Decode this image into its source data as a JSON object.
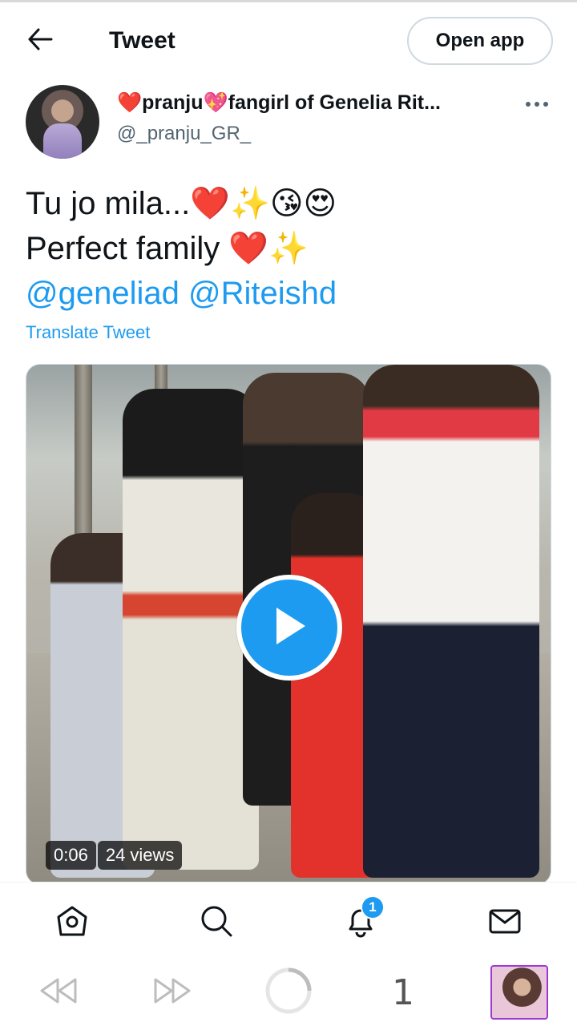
{
  "header": {
    "title": "Tweet",
    "open_app_label": "Open app"
  },
  "author": {
    "name": "❤️pranju💖fangirl of Genelia Rit...",
    "handle": "@_pranju_GR_"
  },
  "tweet": {
    "line1": "Tu jo mila...❤️✨😘😍",
    "line2": "Perfect family ❤️✨",
    "mentions": [
      "@geneliad",
      "@Riteishd"
    ],
    "translate_label": "Translate Tweet"
  },
  "media": {
    "duration": "0:06",
    "views": "24 views"
  },
  "nav": {
    "notification_count": "1"
  },
  "browser": {
    "tab_count": "1"
  },
  "colors": {
    "accent": "#1d9bf0",
    "text": "#0f1419",
    "secondary": "#536471"
  }
}
